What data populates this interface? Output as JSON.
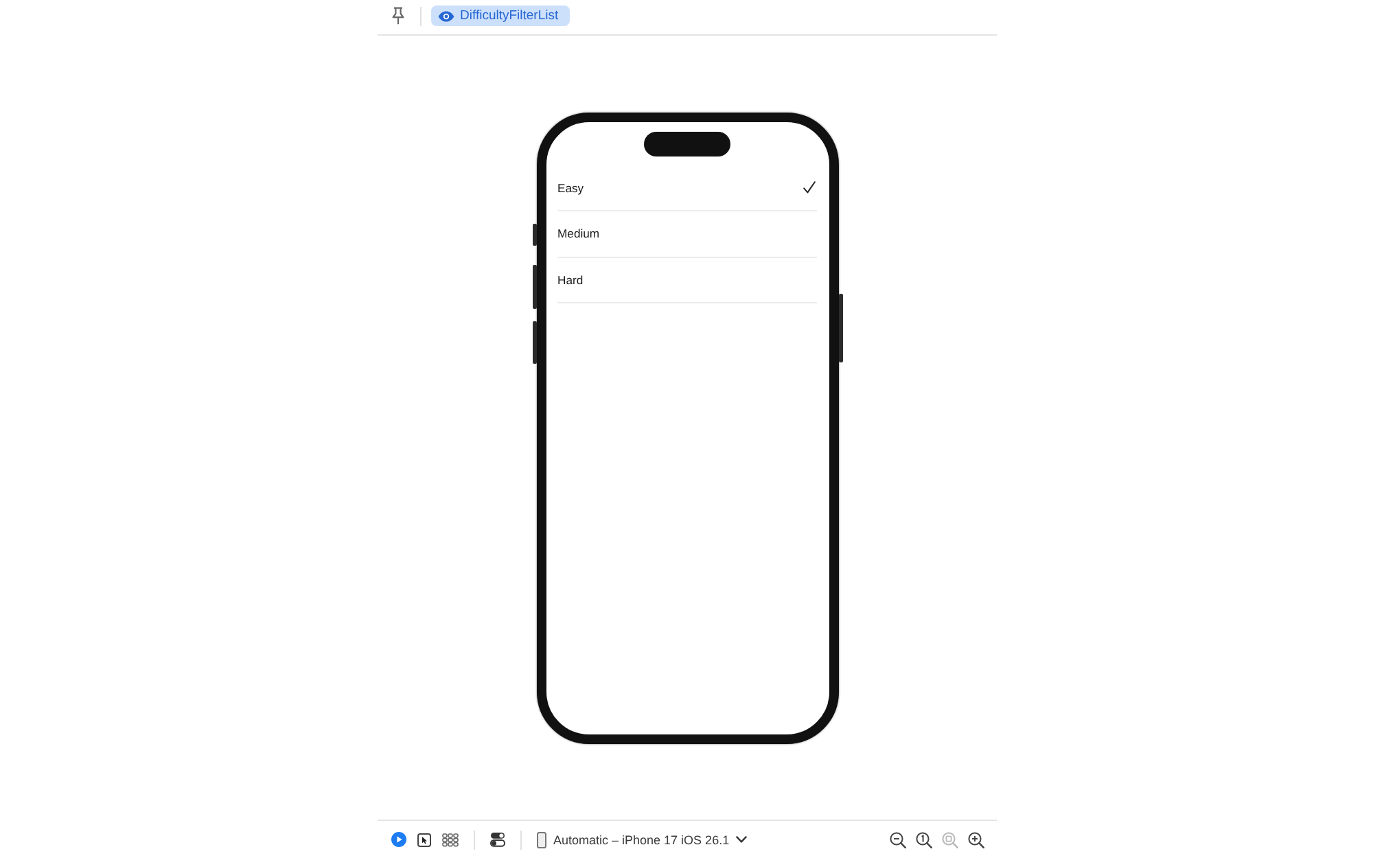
{
  "top_bar": {
    "preview_tab": {
      "label": "DifficultyFilterList",
      "selected": true
    }
  },
  "list": {
    "rows": [
      {
        "label": "Easy",
        "selected": true
      },
      {
        "label": "Medium",
        "selected": false
      },
      {
        "label": "Hard",
        "selected": false
      }
    ]
  },
  "bottom_bar": {
    "modes": [
      {
        "kind": "live",
        "selected": true
      },
      {
        "kind": "select",
        "selected": false
      }
    ],
    "device_label": "Automatic – iPhone 17 iOS 26.1",
    "zoom_buttons": [
      {
        "kind": "out",
        "disabled": false
      },
      {
        "kind": "actual",
        "disabled": false
      },
      {
        "kind": "fit",
        "disabled": true
      },
      {
        "kind": "in",
        "disabled": false
      }
    ]
  }
}
